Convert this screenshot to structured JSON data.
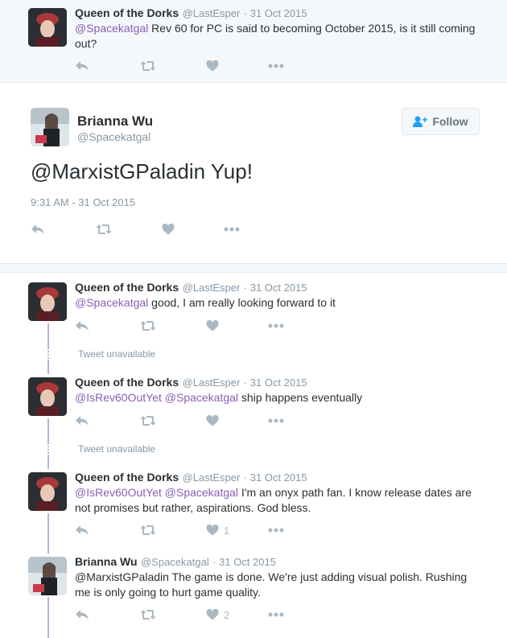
{
  "top_tweet": {
    "name": "Queen of the Dorks",
    "handle": "@LastEsper",
    "date": "· 31 Oct 2015",
    "mention": "@Spacekatgal",
    "text": " Rev 60 for PC is said to becoming October 2015, is it still coming out?"
  },
  "main_tweet": {
    "name": "Brianna Wu",
    "handle": "@Spacekatgal",
    "follow_label": "Follow",
    "text": "@MarxistGPaladin Yup!",
    "timestamp": "9:31 AM - 31 Oct 2015"
  },
  "replies": [
    {
      "name": "Queen of the Dorks",
      "handle": "@LastEsper",
      "date": "· 31 Oct 2015",
      "mention1": "@Spacekatgal",
      "text": " good, I am really looking forward to it",
      "likes": ""
    },
    {
      "name": "Queen of the Dorks",
      "handle": "@LastEsper",
      "date": "· 31 Oct 2015",
      "mention1": "@IsRev60OutYet",
      "mention2": "@Spacekatgal",
      "text": " ship happens eventually",
      "likes": ""
    },
    {
      "name": "Queen of the Dorks",
      "handle": "@LastEsper",
      "date": "· 31 Oct 2015",
      "mention1": "@IsRev60OutYet",
      "mention2": "@Spacekatgal",
      "text": " I'm an onyx path fan. I know release dates are not promises but rather, aspirations. God bless.",
      "likes": "1"
    },
    {
      "name": "Brianna Wu",
      "handle": "@Spacekatgal",
      "date": "· 31 Oct 2015",
      "text": "@MarxistGPaladin The game is done. We're just adding visual polish. Rushing me is only going to hurt game quality.",
      "likes": "2"
    }
  ],
  "tweet_unavailable": "Tweet unavailable",
  "icons": [
    "reply-icon",
    "retweet-icon",
    "heart-icon",
    "more-icon",
    "follow-person-icon"
  ],
  "colors": {
    "mention": "#8a5fb6",
    "thread": "#c8a9e4",
    "muted": "#8899a6",
    "icon": "#aab8c2"
  }
}
